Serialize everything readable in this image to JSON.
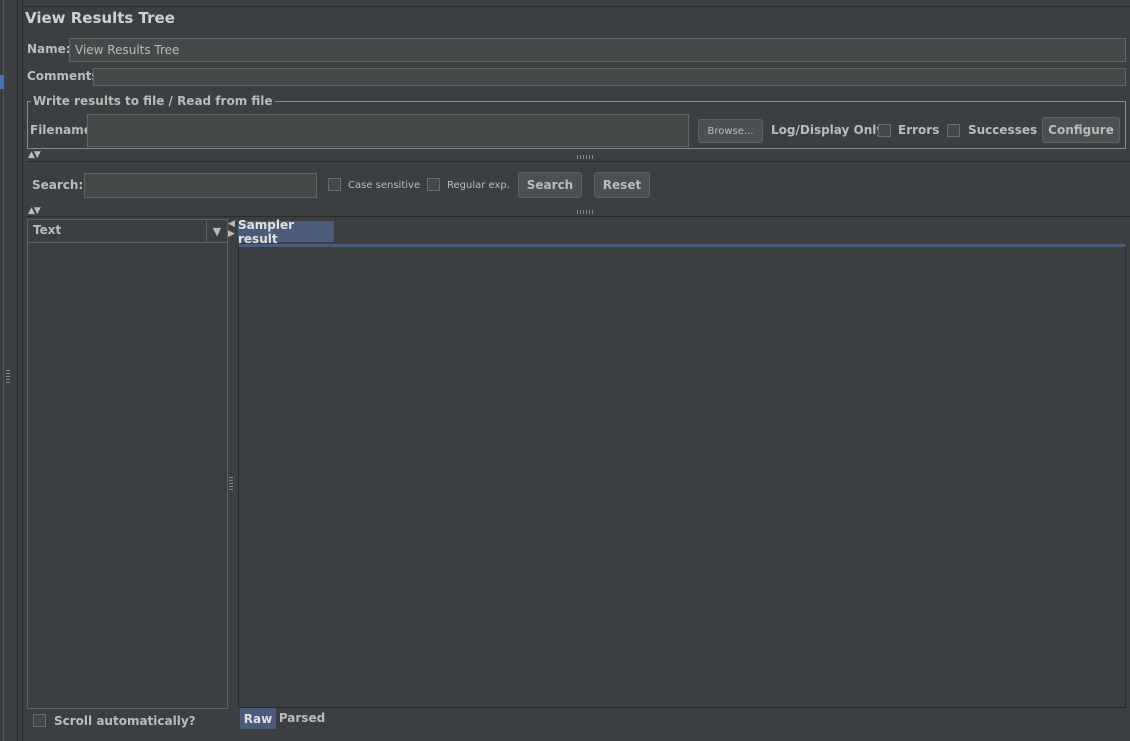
{
  "title": "View Results Tree",
  "name": {
    "label": "Name:",
    "value": "View Results Tree"
  },
  "comments": {
    "label": "Comments:",
    "value": ""
  },
  "file_group": {
    "legend": "Write results to file / Read from file",
    "filename_label": "Filename",
    "filename_value": "",
    "browse_label": "Browse...",
    "log_display_label": "Log/Display Only:",
    "errors_label": "Errors",
    "successes_label": "Successes",
    "configure_label": "Configure"
  },
  "search": {
    "label": "Search:",
    "value": "",
    "case_sensitive_label": "Case sensitive",
    "regex_label": "Regular exp.",
    "search_button": "Search",
    "reset_button": "Reset"
  },
  "tree": {
    "renderer_selected": "Text",
    "scroll_auto_label": "Scroll automatically?"
  },
  "result": {
    "tab_label": "Sampler result",
    "bottom_tabs": [
      "Raw",
      "Parsed"
    ]
  },
  "colors": {
    "background": "#3c3f41",
    "accent": "#4b5b7a",
    "text": "#bbbbbb"
  }
}
